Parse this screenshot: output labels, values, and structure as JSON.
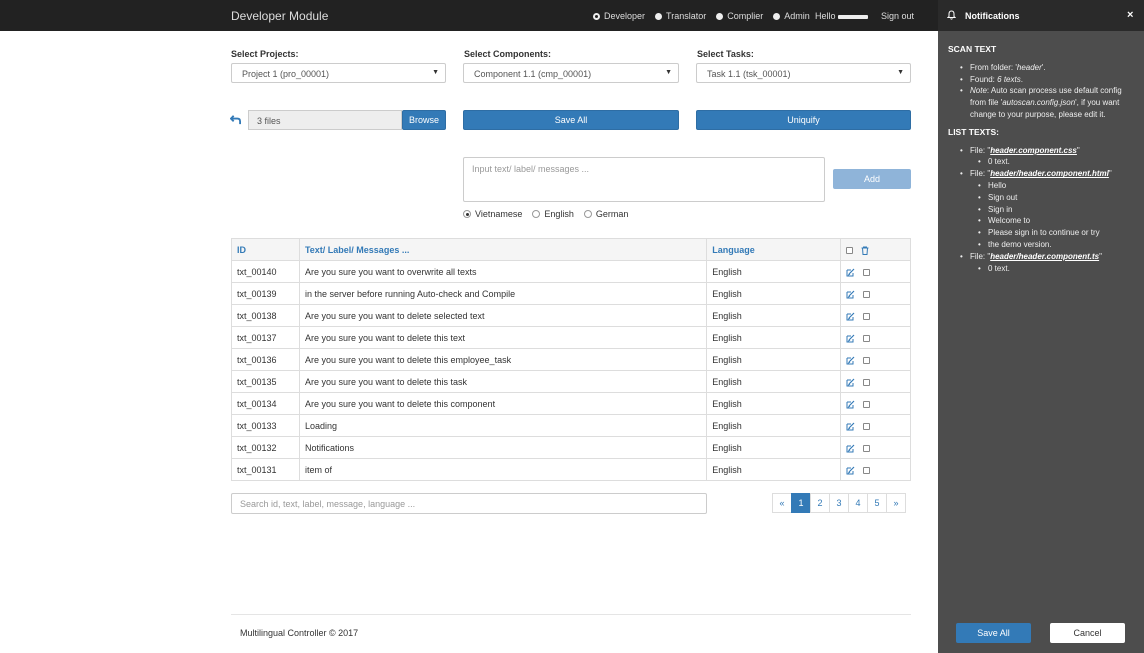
{
  "nav": {
    "brand": "Developer Module",
    "roles": [
      {
        "label": "Developer",
        "selected": true
      },
      {
        "label": "Translator",
        "selected": false
      },
      {
        "label": "Complier",
        "selected": false
      },
      {
        "label": "Admin",
        "selected": false
      }
    ],
    "hello": "Hello",
    "signout": "Sign out"
  },
  "filters": {
    "projects_label": "Select Projects:",
    "projects_value": "Project 1 (pro_00001)",
    "components_label": "Select Components:",
    "components_value": "Component 1.1 (cmp_00001)",
    "tasks_label": "Select Tasks:",
    "tasks_value": "Task 1.1 (tsk_00001)"
  },
  "files": {
    "count": "3 files",
    "browse": "Browse",
    "save_all": "Save All",
    "uniquify": "Uniquify"
  },
  "input": {
    "placeholder": "Input text/ label/ messages ...",
    "add": "Add",
    "languages": [
      {
        "label": "Vietnamese",
        "selected": true
      },
      {
        "label": "English",
        "selected": false
      },
      {
        "label": "German",
        "selected": false
      }
    ]
  },
  "table": {
    "headers": [
      "ID",
      "Text/ Label/ Messages ...",
      "Language"
    ],
    "rows": [
      {
        "id": "txt_00140",
        "text": "Are you sure you want to overwrite all texts",
        "lang": "English"
      },
      {
        "id": "txt_00139",
        "text": "in the server before running Auto-check and Compile",
        "lang": "English"
      },
      {
        "id": "txt_00138",
        "text": "Are you sure you want to delete selected text",
        "lang": "English"
      },
      {
        "id": "txt_00137",
        "text": "Are you sure you want to delete this text",
        "lang": "English"
      },
      {
        "id": "txt_00136",
        "text": "Are you sure you want to delete this employee_task",
        "lang": "English"
      },
      {
        "id": "txt_00135",
        "text": "Are you sure you want to delete this task",
        "lang": "English"
      },
      {
        "id": "txt_00134",
        "text": "Are you sure you want to delete this component",
        "lang": "English"
      },
      {
        "id": "txt_00133",
        "text": "Loading",
        "lang": "English"
      },
      {
        "id": "txt_00132",
        "text": "Notifications",
        "lang": "English"
      },
      {
        "id": "txt_00131",
        "text": "item of",
        "lang": "English"
      }
    ]
  },
  "search": {
    "placeholder": "Search id, text, label, message, language ..."
  },
  "pagination": {
    "prev": "«",
    "pages": [
      "1",
      "2",
      "3",
      "4",
      "5"
    ],
    "active": "1",
    "next": "»"
  },
  "footer": "Multilingual Controller © 2017",
  "panel": {
    "title": "Notifications",
    "close": "×",
    "scan_title": "SCAN TEXT",
    "scan_folder_prefix": "From folder: '",
    "scan_folder": "header",
    "scan_folder_suffix": "'.",
    "scan_found_prefix": "Found: ",
    "scan_found": "6 texts",
    "scan_found_suffix": ".",
    "scan_note_label": "Note",
    "scan_note_text": ": Auto scan process use default config from file '",
    "scan_note_file": "autoscan.config.json",
    "scan_note_rest": "', if you want change to your purpose, please edit it.",
    "list_title": "LIST TEXTS:",
    "file_prefix": "File: \"",
    "file_suffix": "\"",
    "files": [
      {
        "name": "header.component.css",
        "texts": [
          "0 text."
        ]
      },
      {
        "name": "header/header.component.html",
        "texts": [
          "Hello",
          "Sign out",
          "Sign in",
          "Welcome to",
          "Please sign in to continue or try",
          "the demo version."
        ]
      },
      {
        "name": "header/header.component.ts",
        "texts": [
          "0 text."
        ]
      }
    ],
    "save_all": "Save All",
    "cancel": "Cancel"
  },
  "colors": {
    "primary": "#337ab7",
    "topbar": "#222222",
    "panel": "#4d4d4d"
  }
}
